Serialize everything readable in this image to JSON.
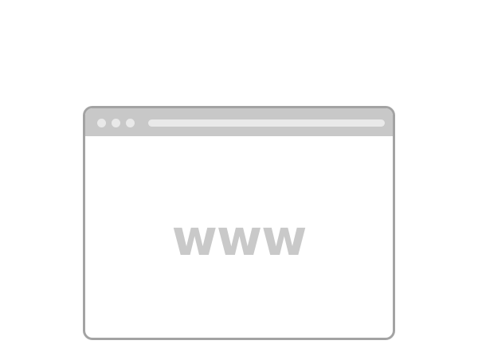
{
  "browser": {
    "content_text": "www"
  },
  "colors": {
    "frame": "#a3a3a3",
    "title_bar": "#c8c8c8",
    "controls": "#e9e9e9",
    "text": "#c9c9c9"
  }
}
